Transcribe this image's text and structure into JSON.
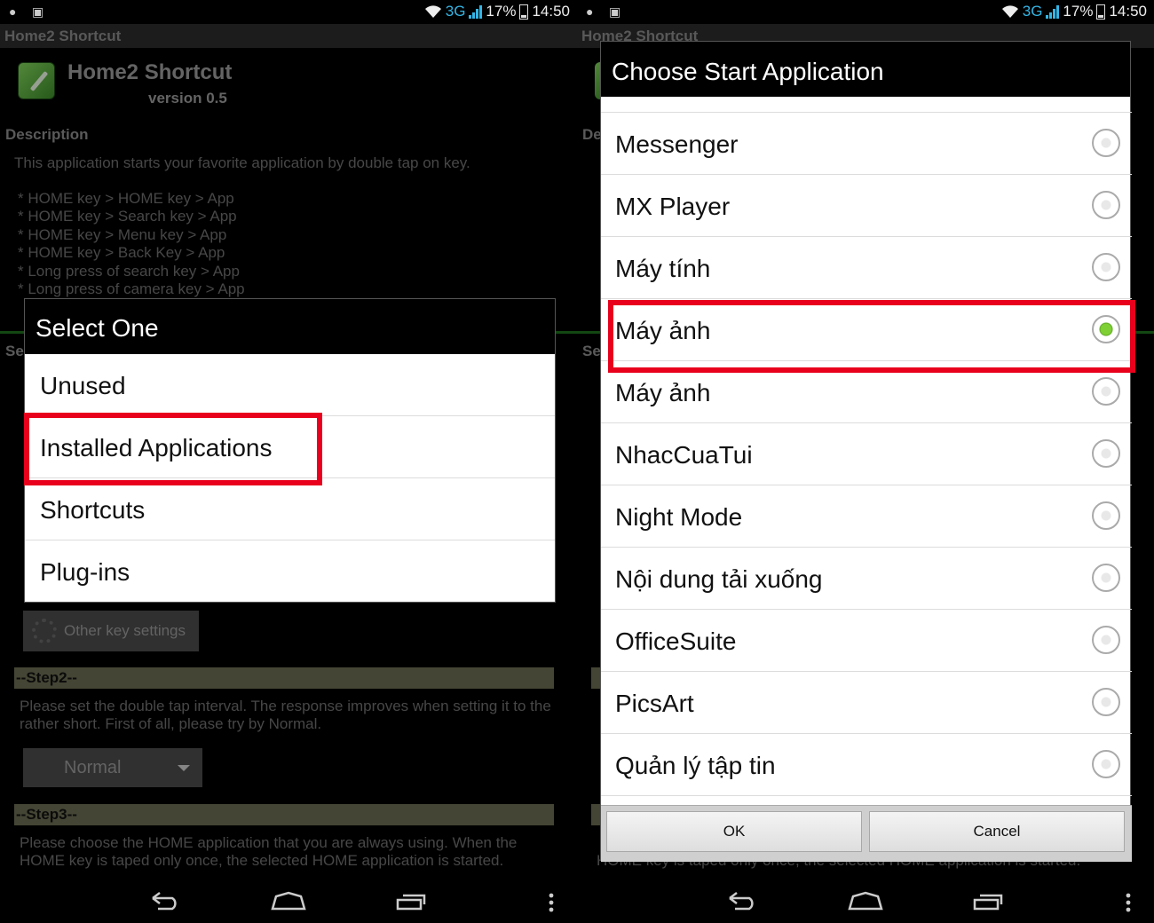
{
  "status": {
    "network": "3G",
    "battery": "17%",
    "time": "14:50"
  },
  "app_title": "Home2 Shortcut",
  "header": {
    "name": "Home2 Shortcut",
    "version": "version 0.5"
  },
  "description": {
    "title": "Description",
    "text": "This application starts your favorite application by double tap on key.",
    "keys": [
      "* HOME key > HOME key > App",
      "* HOME key > Search key > App",
      "* HOME key > Menu key > App",
      "* HOME key > Back Key > App",
      "* Long press of search key > App",
      "* Long press of camera key > App"
    ]
  },
  "settings_label": "Se",
  "other_key_settings": "Other key settings",
  "step2": {
    "title": "--Step2--",
    "text": "Please set the double tap interval. The response improves when setting it to the rather short. First of all, please try by Normal.",
    "interval": "Normal"
  },
  "step3": {
    "title": "--Step3--",
    "text": "Please choose the HOME application that you are always using. When the HOME key is taped only once, the selected HOME application is started.",
    "text_tail": "HOME key is taped only once, the selected HOME application is started."
  },
  "select_dialog": {
    "title": "Select One",
    "options": [
      "Unused",
      "Installed Applications",
      "Shortcuts",
      "Plug-ins"
    ]
  },
  "start_dialog": {
    "title": "Choose Start Application",
    "apps": [
      {
        "name": "Messenger",
        "selected": false
      },
      {
        "name": "MX Player",
        "selected": false
      },
      {
        "name": "Máy tính",
        "selected": false
      },
      {
        "name": "Máy ảnh",
        "selected": true
      },
      {
        "name": "Máy ảnh",
        "selected": false
      },
      {
        "name": "NhacCuaTui",
        "selected": false
      },
      {
        "name": "Night Mode",
        "selected": false
      },
      {
        "name": "Nội dung tải xuống",
        "selected": false
      },
      {
        "name": "OfficeSuite",
        "selected": false
      },
      {
        "name": "PicsArt",
        "selected": false
      },
      {
        "name": "Quản lý tập tin",
        "selected": false
      }
    ],
    "ok": "OK",
    "cancel": "Cancel"
  },
  "right_bg": {
    "de": "De",
    "se": "Se"
  },
  "colors": {
    "highlight": "#e8001c",
    "accent": "#33b5e5",
    "radio_on": "#7fd034"
  }
}
